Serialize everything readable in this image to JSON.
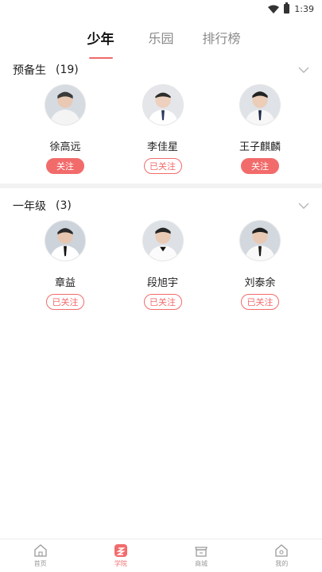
{
  "status_bar": {
    "time": "1:39"
  },
  "tabs": [
    {
      "label": "少年",
      "active": true
    },
    {
      "label": "乐园",
      "active": false
    },
    {
      "label": "排行榜",
      "active": false
    }
  ],
  "sections": [
    {
      "title": "预备生",
      "count": "(19)",
      "members": [
        {
          "name": "徐高远",
          "follow_label": "关注",
          "followed": false
        },
        {
          "name": "李佳星",
          "follow_label": "已关注",
          "followed": true
        },
        {
          "name": "王子麒麟",
          "follow_label": "关注",
          "followed": false
        }
      ]
    },
    {
      "title": "一年级",
      "count": "(3)",
      "members": [
        {
          "name": "章益",
          "follow_label": "已关注",
          "followed": true
        },
        {
          "name": "段旭宇",
          "follow_label": "已关注",
          "followed": true
        },
        {
          "name": "刘泰余",
          "follow_label": "已关注",
          "followed": true
        }
      ]
    }
  ],
  "bottom_nav": [
    {
      "label": "首页",
      "icon": "home-icon",
      "active": false
    },
    {
      "label": "学院",
      "icon": "academy-icon",
      "active": true
    },
    {
      "label": "商城",
      "icon": "shop-icon",
      "active": false
    },
    {
      "label": "我的",
      "icon": "profile-icon",
      "active": false
    }
  ],
  "colors": {
    "accent": "#f26b6b",
    "divider": "#f2f2f2",
    "inactive": "#9a9a9a"
  }
}
